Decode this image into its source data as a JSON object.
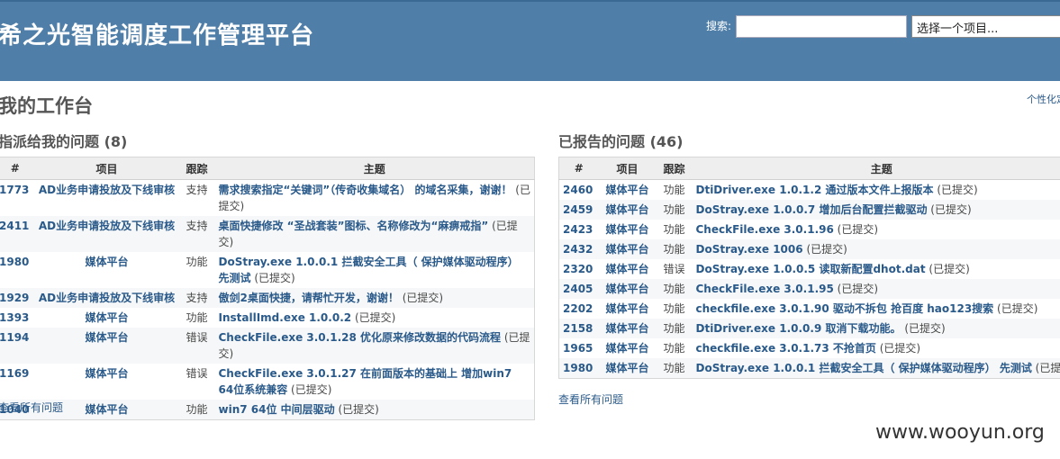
{
  "header": {
    "title": "希之光智能调度工作管理平台",
    "search_label": "搜索:",
    "search_value": "",
    "project_select": "选择一个项目..."
  },
  "page": {
    "title": "我的工作台",
    "personalize": "个性化定"
  },
  "columns": {
    "id": "#",
    "project": "项目",
    "tracker": "跟踪",
    "subject": "主题"
  },
  "assigned": {
    "title": "指派给我的问题 (8)",
    "view_all": "查看所有问题",
    "rows": [
      {
        "id": "1773",
        "project": "AD业务申请投放及下线审核",
        "tracker": "支持",
        "subject": "需求搜索指定“关键词”（传奇收集域名） 的域名采集，谢谢！",
        "status": "(已提交)"
      },
      {
        "id": "2411",
        "project": "AD业务申请投放及下线审核",
        "tracker": "支持",
        "subject": "桌面快捷修改 “圣战套装”图标、名称修改为“麻痹戒指”",
        "status": "(已提交)"
      },
      {
        "id": "1980",
        "project": "媒体平台",
        "tracker": "功能",
        "subject": "DoStray.exe 1.0.0.1 拦截安全工具（ 保护媒体驱动程序） 先测试",
        "status": "(已提交)"
      },
      {
        "id": "1929",
        "project": "AD业务申请投放及下线审核",
        "tracker": "支持",
        "subject": "傲剑2桌面快捷，请帮忙开发，谢谢！",
        "status": "(已提交)"
      },
      {
        "id": "1393",
        "project": "媒体平台",
        "tracker": "功能",
        "subject": "InstallImd.exe 1.0.0.2",
        "status": "(已提交)"
      },
      {
        "id": "1194",
        "project": "媒体平台",
        "tracker": "错误",
        "subject": "CheckFile.exe 3.0.1.28 优化原来修改数据的代码流程",
        "status": "(已提交)"
      },
      {
        "id": "1169",
        "project": "媒体平台",
        "tracker": "错误",
        "subject": "CheckFile.exe 3.0.1.27 在前面版本的基础上 增加win7 64位系统兼容",
        "status": "(已提交)"
      },
      {
        "id": "1040",
        "project": "媒体平台",
        "tracker": "功能",
        "subject": "win7 64位 中间层驱动",
        "status": "(已提交)"
      }
    ]
  },
  "reported": {
    "title": "已报告的问题 (46)",
    "view_all": "查看所有问题",
    "rows": [
      {
        "id": "2460",
        "project": "媒体平台",
        "tracker": "功能",
        "subject": "DtiDriver.exe 1.0.1.2 通过版本文件上报版本",
        "status": "(已提交)"
      },
      {
        "id": "2459",
        "project": "媒体平台",
        "tracker": "功能",
        "subject": "DoStray.exe 1.0.0.7 增加后台配置拦截驱动",
        "status": "(已提交)"
      },
      {
        "id": "2423",
        "project": "媒体平台",
        "tracker": "功能",
        "subject": "CheckFile.exe 3.0.1.96",
        "status": "(已提交)"
      },
      {
        "id": "2432",
        "project": "媒体平台",
        "tracker": "功能",
        "subject": "DoStray.exe 1006",
        "status": "(已提交)"
      },
      {
        "id": "2320",
        "project": "媒体平台",
        "tracker": "错误",
        "subject": "DoStray.exe 1.0.0.5 读取新配置dhot.dat",
        "status": "(已提交)"
      },
      {
        "id": "2405",
        "project": "媒体平台",
        "tracker": "功能",
        "subject": "CheckFile.exe 3.0.1.95",
        "status": "(已提交)"
      },
      {
        "id": "2202",
        "project": "媒体平台",
        "tracker": "功能",
        "subject": "checkfile.exe 3.0.1.90 驱动不拆包 抢百度 hao123搜索",
        "status": "(已提交)"
      },
      {
        "id": "2158",
        "project": "媒体平台",
        "tracker": "功能",
        "subject": "DtiDriver.exe 1.0.0.9 取消下载功能。",
        "status": "(已提交)"
      },
      {
        "id": "1965",
        "project": "媒体平台",
        "tracker": "功能",
        "subject": "checkfile.exe 3.0.1.73 不抢首页",
        "status": "(已提交)"
      },
      {
        "id": "1980",
        "project": "媒体平台",
        "tracker": "功能",
        "subject": "DoStray.exe 1.0.0.1 拦截安全工具（ 保护媒体驱动程序） 先测试",
        "status": "(已提交)"
      }
    ]
  },
  "watermark": "www.wooyun.org"
}
